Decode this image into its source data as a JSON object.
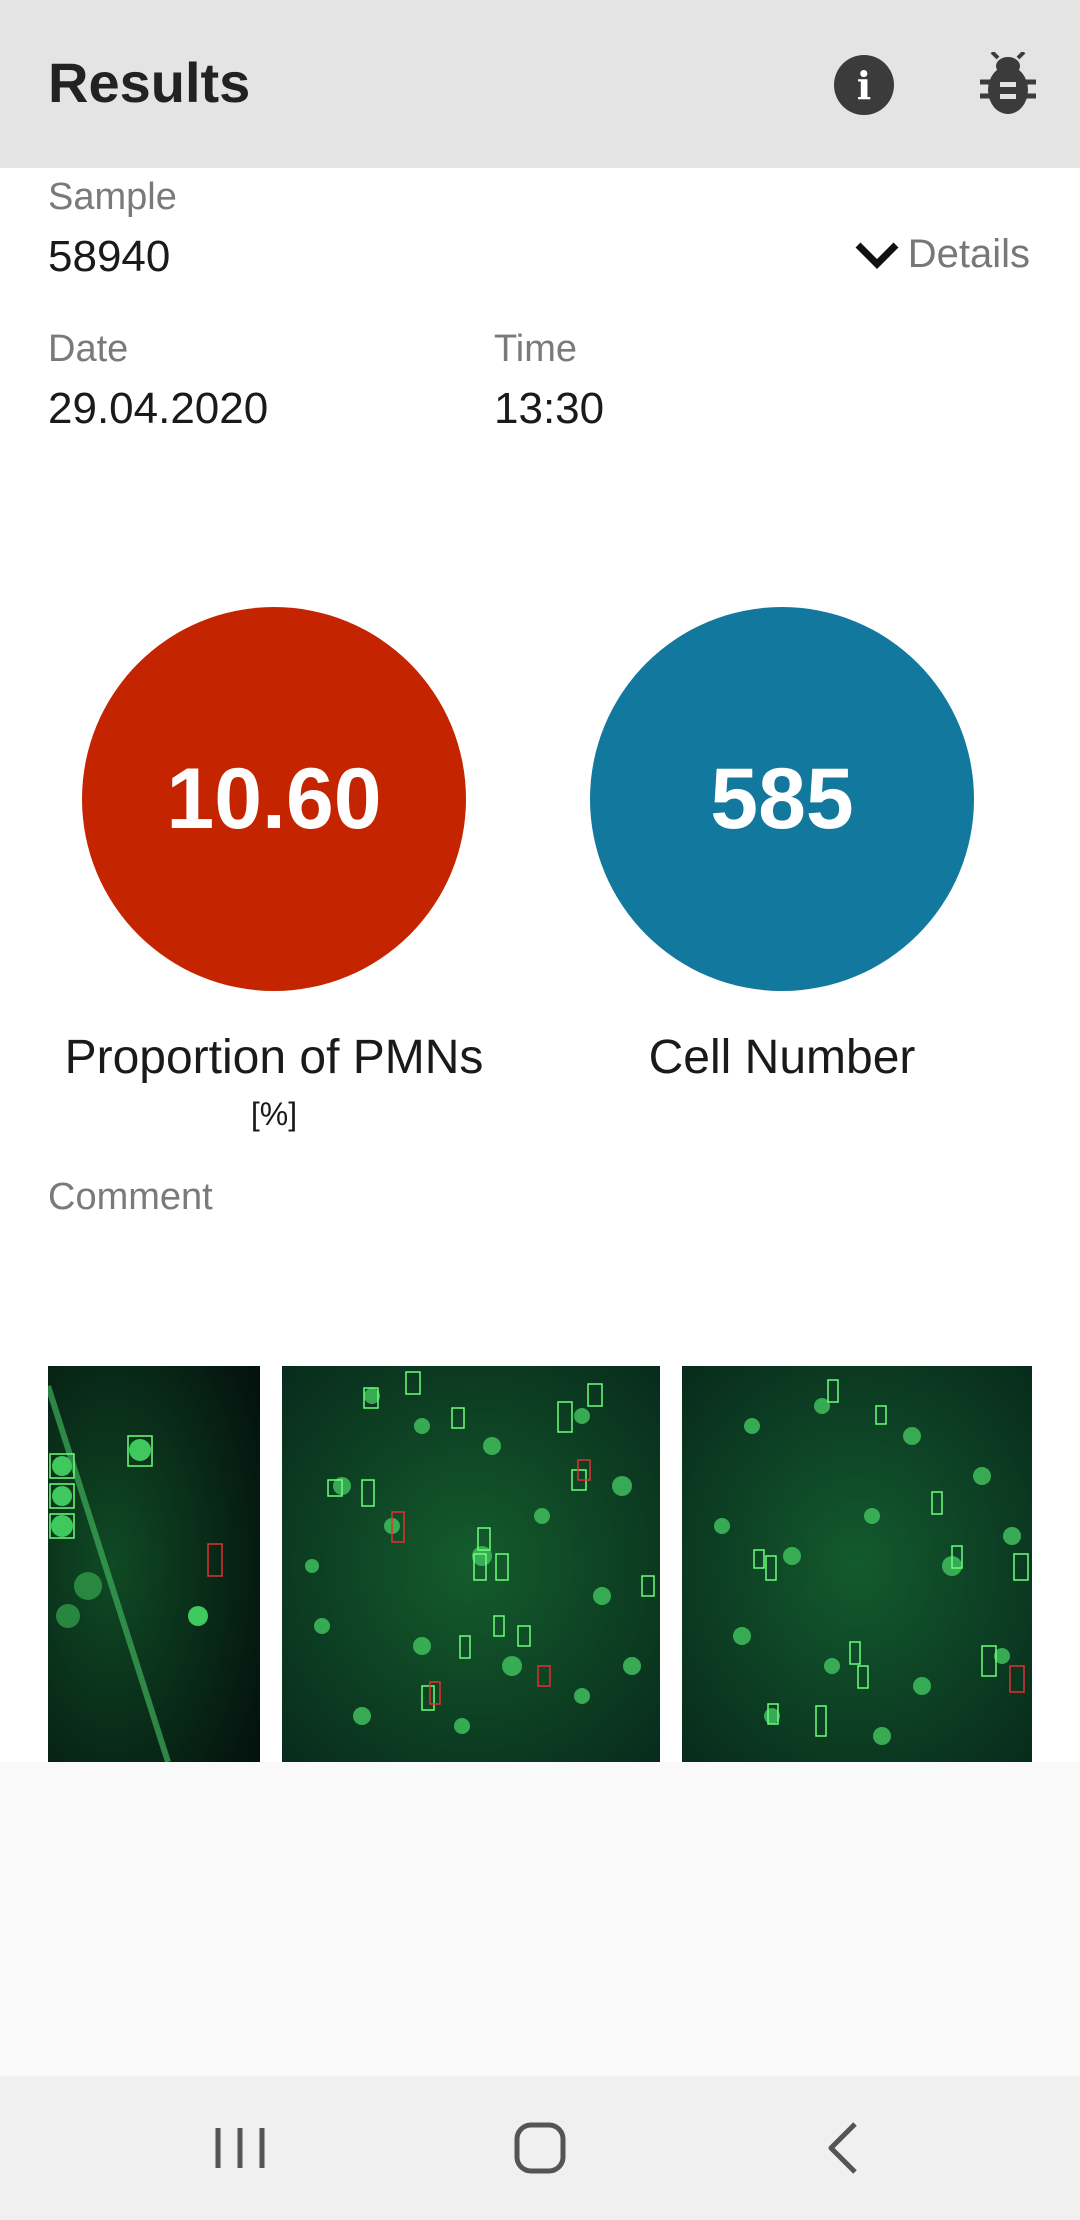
{
  "app_bar": {
    "title": "Results",
    "info_icon": "info-icon",
    "bug_icon": "bug-icon"
  },
  "sample": {
    "label": "Sample",
    "value": "58940"
  },
  "details_toggle": {
    "label": "Details",
    "icon": "chevron-down-icon"
  },
  "date": {
    "label": "Date",
    "value": "29.04.2020"
  },
  "time": {
    "label": "Time",
    "value": "13:30"
  },
  "metrics": [
    {
      "value": "10.60",
      "label": "Proportion of PMNs",
      "unit": "[%]",
      "color": "#c42500"
    },
    {
      "value": "585",
      "label": "Cell Number",
      "color": "#13789e"
    }
  ],
  "comment": {
    "label": "Comment",
    "value": ""
  },
  "images": [
    {
      "name": "micrograph-1"
    },
    {
      "name": "micrograph-2"
    },
    {
      "name": "micrograph-3"
    }
  ],
  "nav_bar": {
    "recents_icon": "recents-icon",
    "home_icon": "home-icon",
    "back_icon": "back-icon"
  }
}
